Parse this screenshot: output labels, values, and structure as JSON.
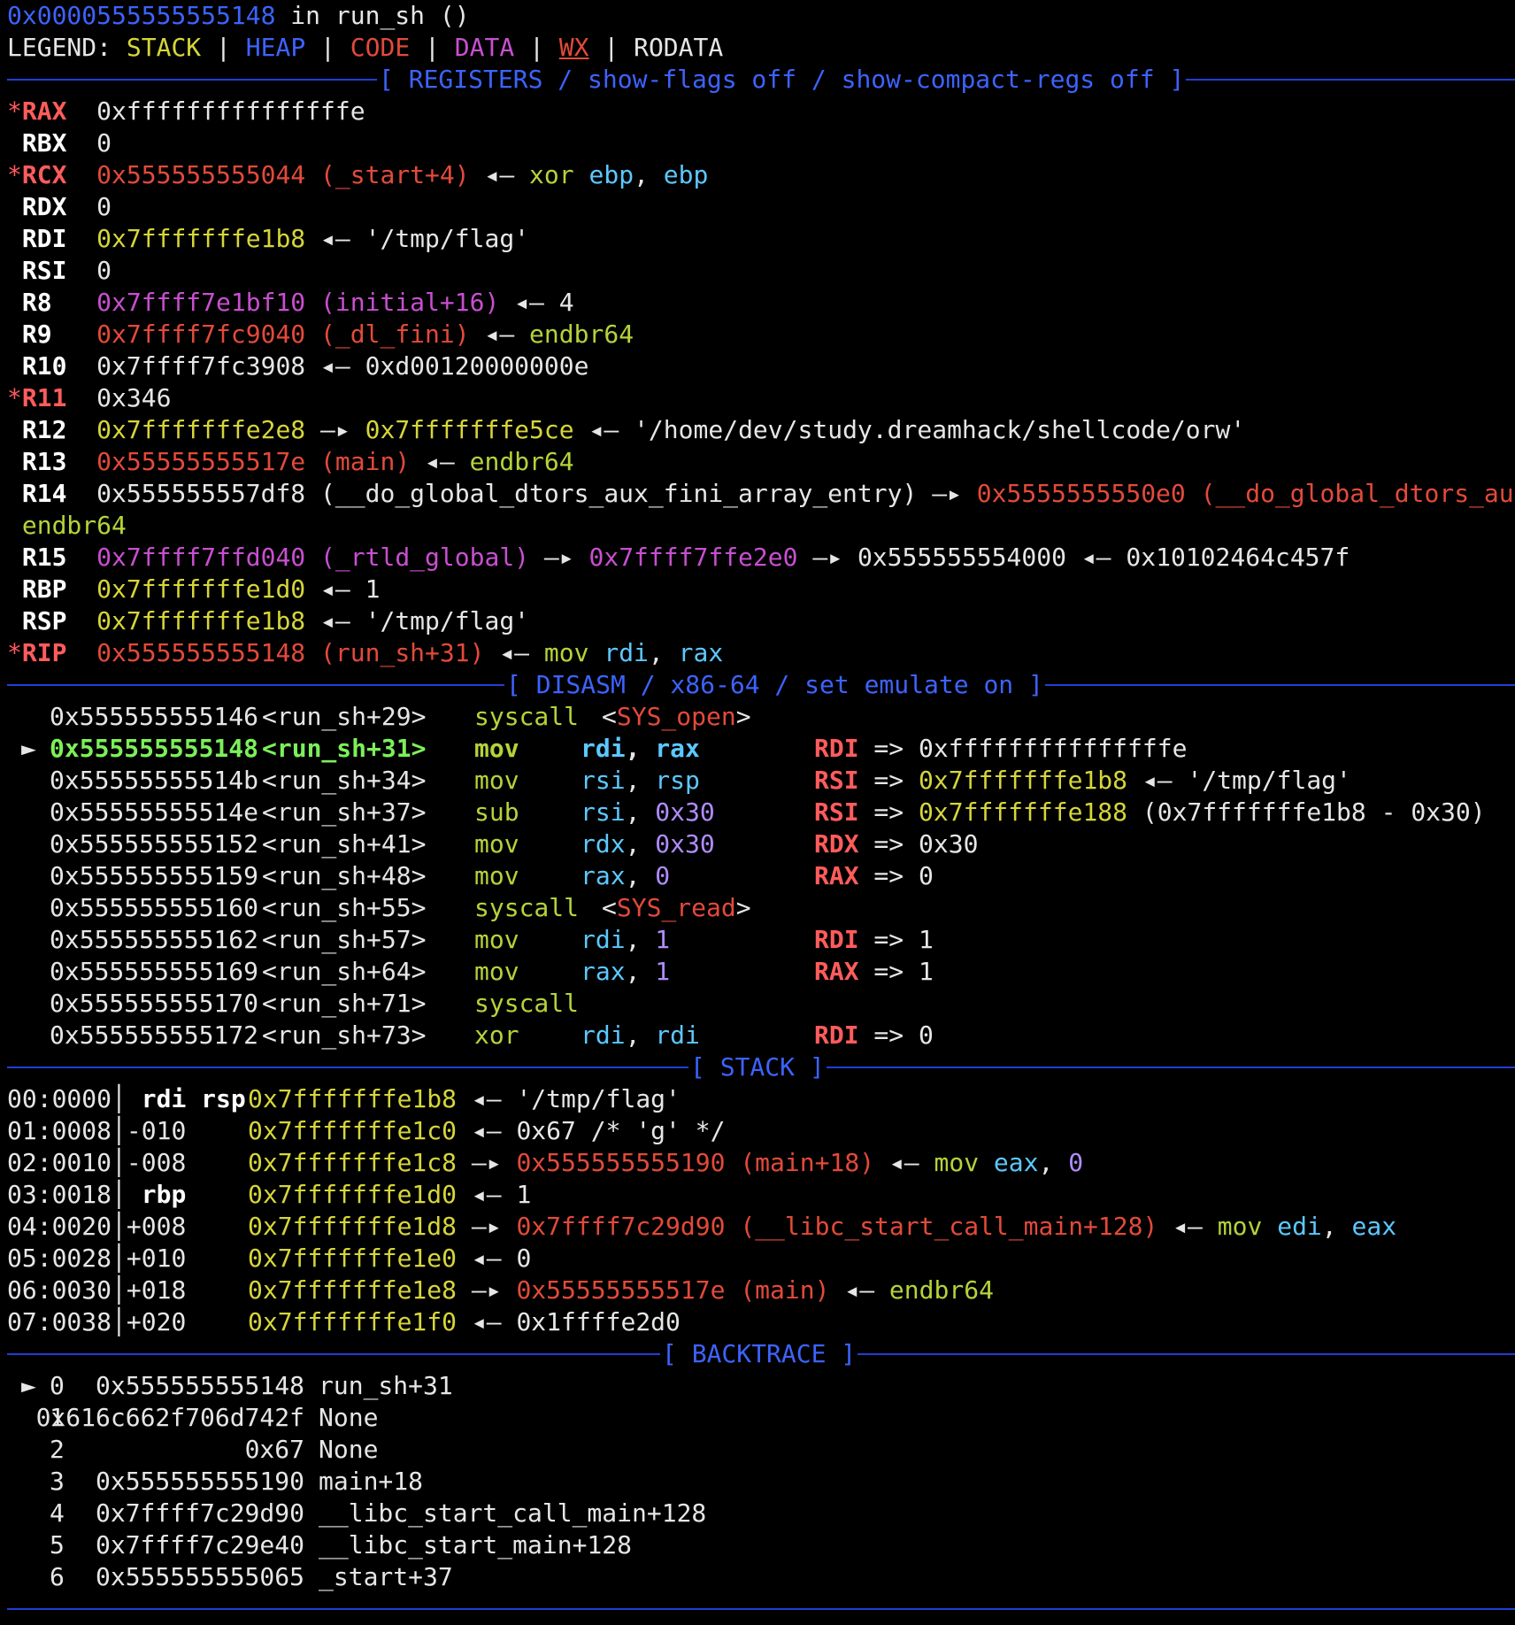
{
  "header": {
    "frame_addr": "0x0000555555555148",
    "frame_rest": " in run_sh ()",
    "legend_label": "LEGEND:",
    "legend": [
      "STACK",
      "HEAP",
      "CODE",
      "DATA",
      "WX",
      "RODATA"
    ],
    "legend_sep": " | "
  },
  "colors": {
    "stack": "#d6d63a",
    "heap": "#3d63ff",
    "code": "#e34a3a",
    "data": "#c84fd0",
    "rule": "#1f3fd6",
    "mnemonic": "#b5d33a",
    "operand": "#5cc8ff",
    "immediate": "#b08cff",
    "current": "#7cf05a",
    "changed_reg": "#ff5c5c"
  },
  "sections": {
    "registers": "[ REGISTERS / show-flags off / show-compact-regs off ]",
    "disasm": "[ DISASM / x86-64 / set emulate on ]",
    "stack": "[ STACK ]",
    "backtrace": "[ BACKTRACE ]"
  },
  "registers": [
    {
      "star": "*",
      "name": "RAX",
      "value": "0xfffffffffffffffe"
    },
    {
      "star": " ",
      "name": "RBX",
      "value": "0"
    },
    {
      "star": "*",
      "name": "RCX",
      "addr": "0x555555555044",
      "sym": "(_start+4)",
      "arrow": "◂—",
      "ins": "xor",
      "op1": "ebp",
      "op2": "ebp"
    },
    {
      "star": " ",
      "name": "RDX",
      "value": "0"
    },
    {
      "star": " ",
      "name": "RDI",
      "addr": "0x7fffffffe1b8",
      "arrow": "◂—",
      "str": "'/tmp/flag'"
    },
    {
      "star": " ",
      "name": "RSI",
      "value": "0"
    },
    {
      "star": " ",
      "name": "R8",
      "addr": "0x7ffff7e1bf10",
      "sym": "(initial+16)",
      "arrow": "◂—",
      "val": "4"
    },
    {
      "star": " ",
      "name": "R9",
      "addr": "0x7ffff7fc9040",
      "sym": "(_dl_fini)",
      "arrow": "◂—",
      "ins": "endbr64"
    },
    {
      "star": " ",
      "name": "R10",
      "addr": "0x7ffff7fc3908",
      "arrow": "◂—",
      "val": "0xd00120000000e"
    },
    {
      "star": "*",
      "name": "R11",
      "value": "0x346"
    },
    {
      "star": " ",
      "name": "R12",
      "addr": "0x7fffffffe2e8",
      "arrow": "—▸",
      "addr2": "0x7fffffffe5ce",
      "arrow2": "◂—",
      "str": "'/home/dev/study.dreamhack/shellcode/orw'"
    },
    {
      "star": " ",
      "name": "R13",
      "addr": "0x55555555517e",
      "sym": "(main)",
      "arrow": "◂—",
      "ins": "endbr64"
    },
    {
      "star": " ",
      "name": "R14",
      "addr": "0x555555557df8",
      "sym": "(__do_global_dtors_aux_fini_array_entry)",
      "arrow": "—▸",
      "addr2": "0x5555555550e0",
      "sym2": "(__do_global_dtors_aux)",
      "arrow2": "◂—",
      "cont": "endbr64"
    },
    {
      "star": " ",
      "name": "R15",
      "addr": "0x7ffff7ffd040",
      "sym": "(_rtld_global)",
      "arrow": "—▸",
      "addr2": "0x7ffff7ffe2e0",
      "arrow2": "—▸",
      "addr3": "0x555555554000",
      "arrow3": "◂—",
      "val": "0x10102464c457f"
    },
    {
      "star": " ",
      "name": "RBP",
      "addr": "0x7fffffffe1d0",
      "arrow": "◂—",
      "val": "1"
    },
    {
      "star": " ",
      "name": "RSP",
      "addr": "0x7fffffffe1b8",
      "arrow": "◂—",
      "str": "'/tmp/flag'"
    },
    {
      "star": "*",
      "name": "RIP",
      "addr": "0x555555555148",
      "sym": "(run_sh+31)",
      "arrow": "◂—",
      "ins": "mov",
      "op1": "rdi",
      "op2": "rax"
    }
  ],
  "disasm": [
    {
      "marker": " ",
      "addr": "0x555555555146",
      "sym": "<run_sh+29>",
      "mn": "syscall",
      "sys": "SYS_open"
    },
    {
      "marker": "►",
      "addr": "0x555555555148",
      "sym": "<run_sh+31>",
      "mn": "mov",
      "op1": "rdi",
      "op2": "rax",
      "reg": "RDI",
      "res": "0xfffffffffffffffe"
    },
    {
      "marker": " ",
      "addr": "0x55555555514b",
      "sym": "<run_sh+34>",
      "mn": "mov",
      "op1": "rsi",
      "op2": "rsp",
      "reg": "RSI",
      "res_addr": "0x7fffffffe1b8",
      "res_arrow": "◂—",
      "res": "'/tmp/flag'"
    },
    {
      "marker": " ",
      "addr": "0x55555555514e",
      "sym": "<run_sh+37>",
      "mn": "sub",
      "op1": "rsi",
      "op2i": "0x30",
      "reg": "RSI",
      "res_addr": "0x7fffffffe188",
      "res": "(0x7fffffffe1b8 - 0x30)"
    },
    {
      "marker": " ",
      "addr": "0x555555555152",
      "sym": "<run_sh+41>",
      "mn": "mov",
      "op1": "rdx",
      "op2i": "0x30",
      "reg": "RDX",
      "res": "0x30"
    },
    {
      "marker": " ",
      "addr": "0x555555555159",
      "sym": "<run_sh+48>",
      "mn": "mov",
      "op1": "rax",
      "op2i": "0",
      "reg": "RAX",
      "res": "0"
    },
    {
      "marker": " ",
      "addr": "0x555555555160",
      "sym": "<run_sh+55>",
      "mn": "syscall",
      "sys": "SYS_read"
    },
    {
      "marker": " ",
      "addr": "0x555555555162",
      "sym": "<run_sh+57>",
      "mn": "mov",
      "op1": "rdi",
      "op2i": "1",
      "reg": "RDI",
      "res": "1"
    },
    {
      "marker": " ",
      "addr": "0x555555555169",
      "sym": "<run_sh+64>",
      "mn": "mov",
      "op1": "rax",
      "op2i": "1",
      "reg": "RAX",
      "res": "1"
    },
    {
      "marker": " ",
      "addr": "0x555555555170",
      "sym": "<run_sh+71>",
      "mn": "syscall"
    },
    {
      "marker": " ",
      "addr": "0x555555555172",
      "sym": "<run_sh+73>",
      "mn": "xor",
      "op1": "rdi",
      "op2": "rdi",
      "reg": "RDI",
      "res": "0"
    }
  ],
  "stack": [
    {
      "idx": "00:0000",
      "off": " rdi rsp",
      "bold": true,
      "addr": "0x7fffffffe1b8",
      "arrow": "◂—",
      "val": "'/tmp/flag'"
    },
    {
      "idx": "01:0008",
      "off": "-010",
      "addr": "0x7fffffffe1c0",
      "arrow": "◂—",
      "val": "0x67 /* 'g' */"
    },
    {
      "idx": "02:0010",
      "off": "-008",
      "addr": "0x7fffffffe1c8",
      "arrow": "—▸",
      "caddr": "0x555555555190",
      "csym": "(main+18)",
      "arrow2": "◂—",
      "ins": "mov",
      "op1": "eax",
      "op2i": "0"
    },
    {
      "idx": "03:0018",
      "off": " rbp",
      "bold": true,
      "addr": "0x7fffffffe1d0",
      "arrow": "◂—",
      "val": "1"
    },
    {
      "idx": "04:0020",
      "off": "+008",
      "addr": "0x7fffffffe1d8",
      "arrow": "—▸",
      "caddr": "0x7ffff7c29d90",
      "csym": "(__libc_start_call_main+128)",
      "arrow2": "◂—",
      "ins": "mov",
      "op1": "edi",
      "op2": "eax"
    },
    {
      "idx": "05:0028",
      "off": "+010",
      "addr": "0x7fffffffe1e0",
      "arrow": "◂—",
      "val": "0"
    },
    {
      "idx": "06:0030",
      "off": "+018",
      "addr": "0x7fffffffe1e8",
      "arrow": "—▸",
      "caddr": "0x55555555517e",
      "csym": "(main)",
      "arrow2": "◂—",
      "ins": "endbr64"
    },
    {
      "idx": "07:0038",
      "off": "+020",
      "addr": "0x7fffffffe1f0",
      "arrow": "◂—",
      "val": "0x1ffffe2d0"
    }
  ],
  "backtrace": [
    {
      "marker": "►",
      "num": "0",
      "addr": "0x555555555148",
      "fn": "run_sh+31"
    },
    {
      "marker": " ",
      "num": "1",
      "addr": "0x616c662f706d742f",
      "fn": "None"
    },
    {
      "marker": " ",
      "num": "2",
      "addr": "0x67",
      "fn": "None"
    },
    {
      "marker": " ",
      "num": "3",
      "addr": "0x555555555190",
      "fn": "main+18"
    },
    {
      "marker": " ",
      "num": "4",
      "addr": "0x7ffff7c29d90",
      "fn": "__libc_start_call_main+128"
    },
    {
      "marker": " ",
      "num": "5",
      "addr": "0x7ffff7c29e40",
      "fn": "__libc_start_main+128"
    },
    {
      "marker": " ",
      "num": "6",
      "addr": "0x555555555065",
      "fn": "_start+37"
    }
  ]
}
